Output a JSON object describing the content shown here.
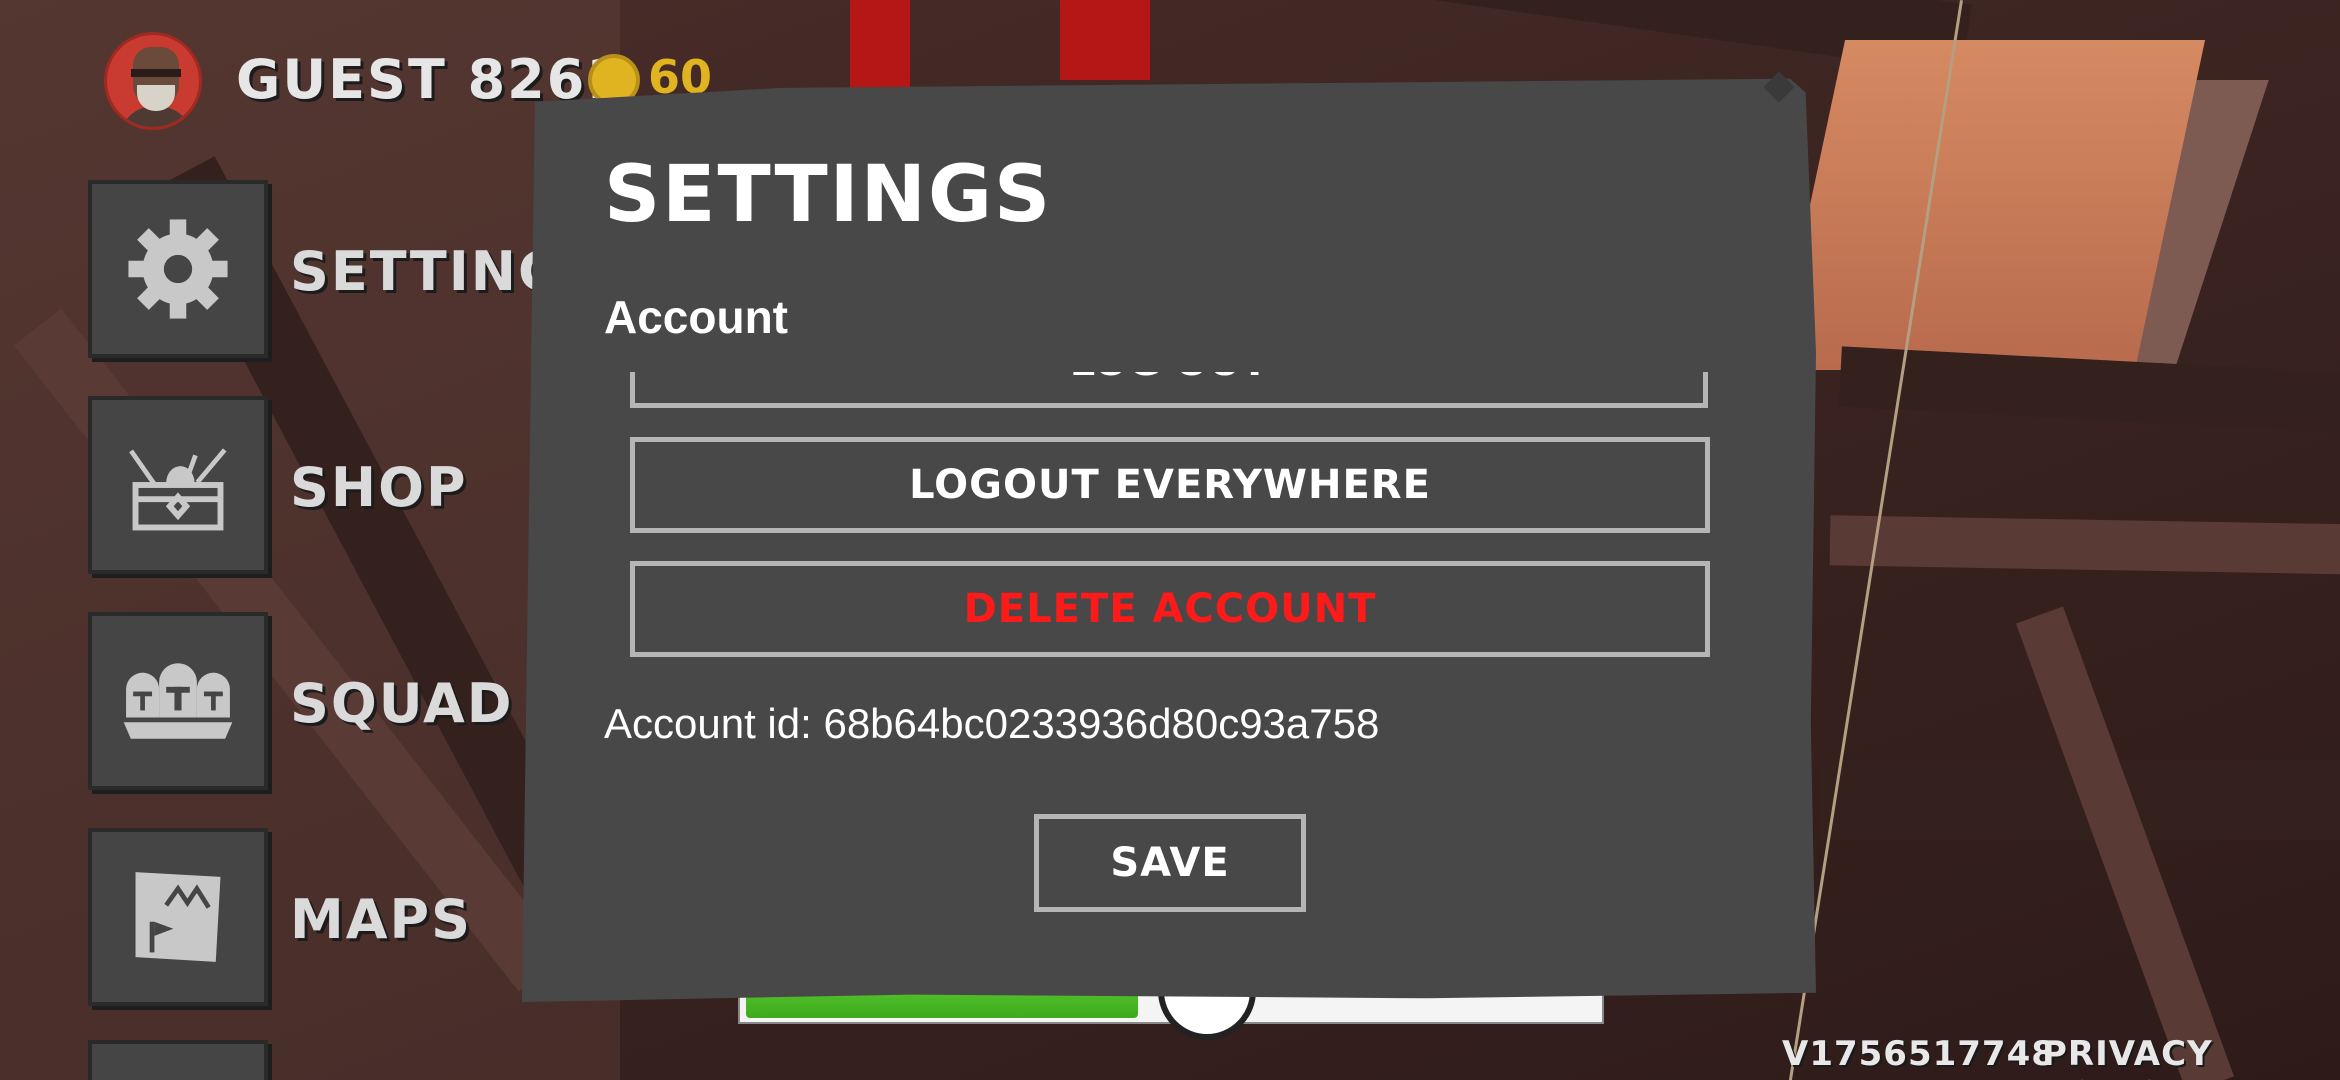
{
  "header": {
    "guest_name": "GUEST 8261",
    "coins": "60"
  },
  "side_menu": {
    "items": [
      {
        "label": "SETTINGS",
        "icon": "gear-icon"
      },
      {
        "label": "SHOP",
        "icon": "treasure-chest-icon"
      },
      {
        "label": "SQUAD",
        "icon": "knight-helmets-icon"
      },
      {
        "label": "MAPS",
        "icon": "map-icon"
      }
    ]
  },
  "settings_modal": {
    "title": "SETTINGS",
    "section_label": "Account",
    "partial_button_label": "LOG OUT",
    "logout_everywhere_label": "LOGOUT EVERYWHERE",
    "delete_account_label": "DELETE ACCOUNT",
    "account_id": "Account id: 68b64bc0233936d80c93a758",
    "save_label": "SAVE"
  },
  "footer": {
    "version": "V1756517748",
    "privacy_policy": "PRIVACY POLICY"
  },
  "colors": {
    "modal_bg": "#484848",
    "tile_bg": "#454545",
    "delete_red": "#ff1a1a",
    "coin_gold": "#e0b320",
    "avatar_red": "#c93a30"
  }
}
